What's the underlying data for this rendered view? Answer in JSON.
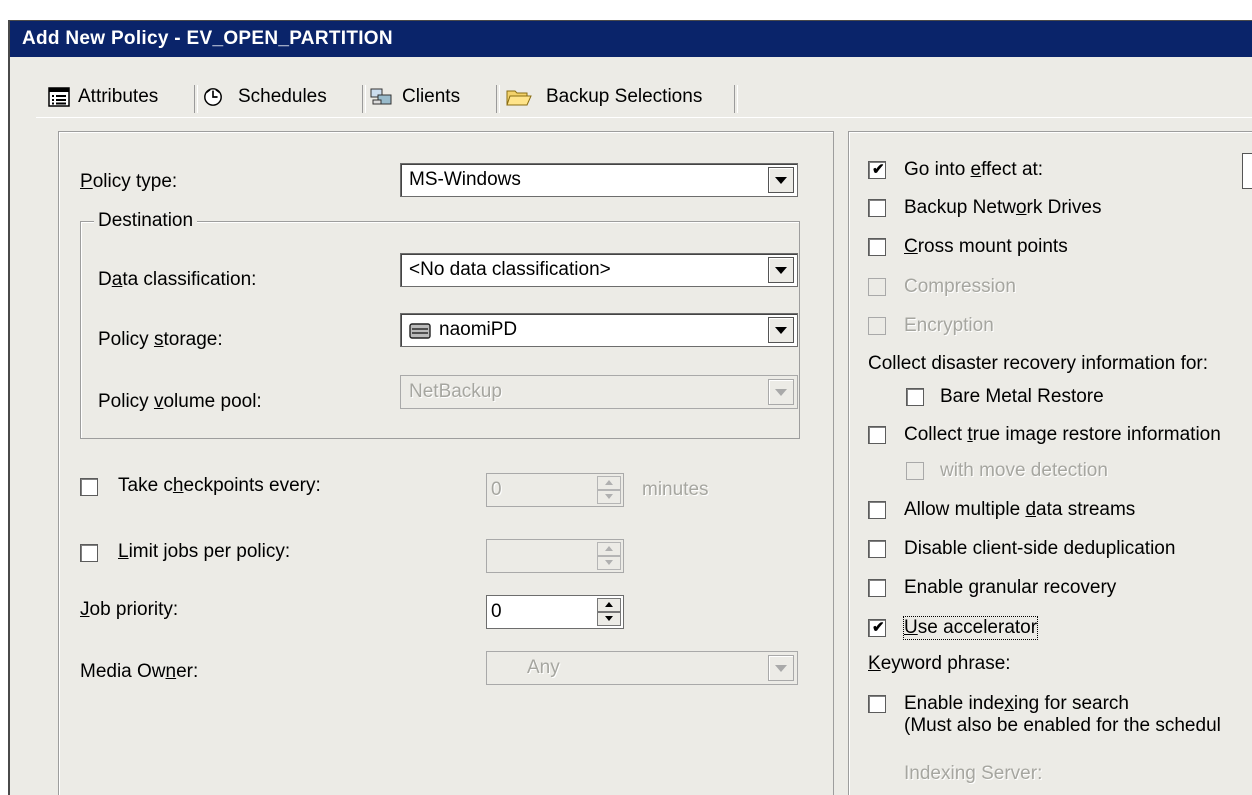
{
  "window": {
    "title": "Add New Policy - EV_OPEN_PARTITION"
  },
  "tabs": [
    {
      "label": "Attributes",
      "icon": "list-icon",
      "selected": true
    },
    {
      "label": "Schedules",
      "icon": "schedule-clock-icon"
    },
    {
      "label": "Clients",
      "icon": "clients-computer-icon"
    },
    {
      "label": "Backup Selections",
      "icon": "folder-icon"
    }
  ],
  "left": {
    "policy_type": {
      "label": "Policy type:",
      "value": "MS-Windows"
    },
    "destination": {
      "title": "Destination",
      "data_classification": {
        "label": "Data classification:",
        "value": "<No data classification>"
      },
      "policy_storage": {
        "label": "Policy storage:",
        "value": "naomiPD",
        "icon": "storage-disk-icon"
      },
      "volume_pool": {
        "label": "Policy volume pool:",
        "value": "NetBackup"
      }
    },
    "checkpoints": {
      "label": "Take checkpoints every:",
      "value": "0",
      "unit": "minutes",
      "checked": false
    },
    "limit_jobs": {
      "label": "Limit jobs per policy:",
      "value": "",
      "checked": false
    },
    "job_priority": {
      "label": "Job priority:",
      "value": "0"
    },
    "media_owner": {
      "label": "Media Owner:",
      "value": "Any"
    }
  },
  "right": {
    "go_into_effect": {
      "label": "Go into effect at:",
      "checked": true
    },
    "backup_network_drives": {
      "label": "Backup Network Drives",
      "checked": false
    },
    "cross_mount_points": {
      "label": "Cross mount points",
      "checked": false
    },
    "compression": {
      "label": "Compression",
      "checked": false
    },
    "encryption": {
      "label": "Encryption",
      "checked": false
    },
    "collect_dr_label": "Collect disaster recovery information for:",
    "bare_metal_restore": {
      "label": "Bare Metal Restore",
      "checked": false
    },
    "collect_true_image": {
      "label": "Collect true image restore information",
      "checked": false
    },
    "with_move_detection": {
      "label": "with move detection",
      "checked": false
    },
    "multiple_data_streams": {
      "label": "Allow multiple data streams",
      "checked": false
    },
    "disable_client_dedup": {
      "label": "Disable client-side deduplication",
      "checked": false
    },
    "granular_recovery": {
      "label": "Enable granular recovery",
      "checked": false
    },
    "use_accelerator": {
      "label": "Use accelerator",
      "checked": true
    },
    "keyword_phrase_label": "Keyword phrase:",
    "enable_indexing": {
      "label": "Enable indexing for search",
      "note": "(Must also be enabled for the schedul",
      "checked": false
    },
    "indexing_server_label": "Indexing Server:"
  },
  "check_mark": "✔"
}
